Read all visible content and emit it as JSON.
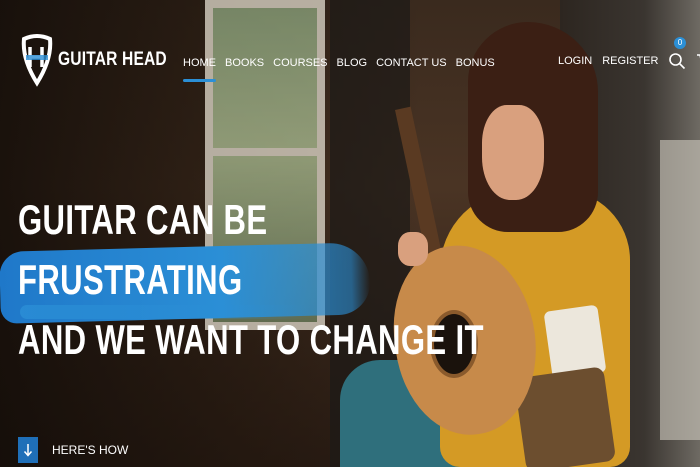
{
  "brand": {
    "name": "GUITAR HEAD"
  },
  "nav": {
    "items": [
      {
        "label": "HOME",
        "active": true
      },
      {
        "label": "BOOKS"
      },
      {
        "label": "COURSES"
      },
      {
        "label": "BLOG"
      },
      {
        "label": "CONTACT US"
      },
      {
        "label": "BONUS"
      }
    ]
  },
  "auth": {
    "login": "LOGIN",
    "register": "REGISTER"
  },
  "cart": {
    "count": "0"
  },
  "hero": {
    "lines": [
      "GUITAR CAN BE",
      "FRUSTRATING",
      "AND WE WANT TO CHANGE IT"
    ],
    "cta": "HERE'S HOW"
  },
  "colors": {
    "accent": "#2b8fd6",
    "text": "#ffffff"
  },
  "icons": {
    "search": "search-icon",
    "cart": "cart-icon",
    "cta": "arrow-down-icon"
  }
}
